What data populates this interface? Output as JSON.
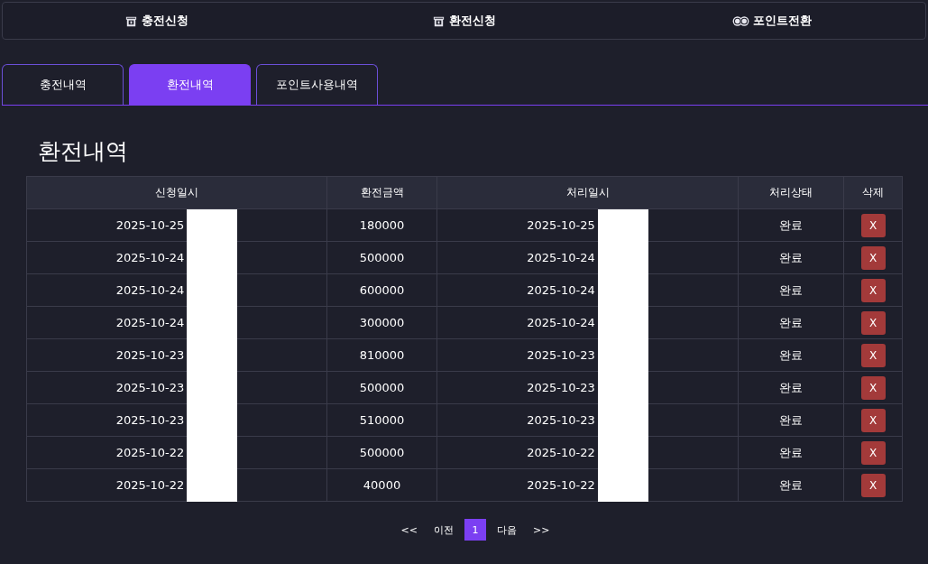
{
  "top_menu": [
    {
      "label": "충전신청",
      "kind": "device"
    },
    {
      "label": "환전신청",
      "kind": "device"
    },
    {
      "label": "포인트전환",
      "kind": "points"
    }
  ],
  "tabs": [
    {
      "label": "충전내역",
      "selected": false
    },
    {
      "label": "환전내역",
      "selected": true
    },
    {
      "label": "포인트사용내역",
      "selected": false
    }
  ],
  "section_title": "환전내역",
  "table": {
    "columns": [
      "신청일시",
      "환전금액",
      "처리일시",
      "처리상태",
      "삭제"
    ],
    "rows": [
      {
        "requested": "2025-10-25",
        "amount": "180000",
        "processed": "2025-10-25",
        "status": "완료",
        "delete": "X"
      },
      {
        "requested": "2025-10-24",
        "amount": "500000",
        "processed": "2025-10-24",
        "status": "완료",
        "delete": "X"
      },
      {
        "requested": "2025-10-24",
        "amount": "600000",
        "processed": "2025-10-24",
        "status": "완료",
        "delete": "X"
      },
      {
        "requested": "2025-10-24",
        "amount": "300000",
        "processed": "2025-10-24",
        "status": "완료",
        "delete": "X"
      },
      {
        "requested": "2025-10-23",
        "amount": "810000",
        "processed": "2025-10-23",
        "status": "완료",
        "delete": "X"
      },
      {
        "requested": "2025-10-23",
        "amount": "500000",
        "processed": "2025-10-23",
        "status": "완료",
        "delete": "X"
      },
      {
        "requested": "2025-10-23",
        "amount": "510000",
        "processed": "2025-10-23",
        "status": "완료",
        "delete": "X"
      },
      {
        "requested": "2025-10-22",
        "amount": "500000",
        "processed": "2025-10-22",
        "status": "완료",
        "delete": "X"
      },
      {
        "requested": "2025-10-22",
        "amount": "40000",
        "processed": "2025-10-22",
        "status": "완료",
        "delete": "X"
      }
    ]
  },
  "pagination": {
    "first": "<<",
    "prev": "이전",
    "pages": [
      {
        "label": "1",
        "selected": true
      }
    ],
    "next": "다음",
    "last": ">>"
  }
}
